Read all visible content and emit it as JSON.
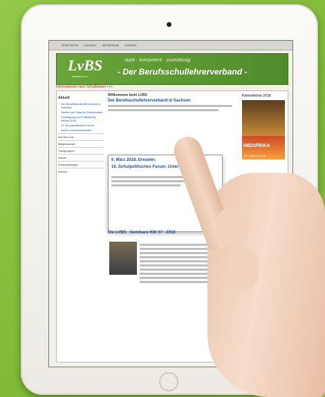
{
  "topbar": [
    "STARTSEITE",
    "KONTAKT",
    "IMPRESSUM",
    "SITEMAP"
  ],
  "banner": {
    "logo": "LvBS",
    "logo_sub": "Sachsen e.V.",
    "tagline": "stark · kompetent · zuverlässig",
    "title": "- Der Berufsschullehrerverband -"
  },
  "ticker": "Informationen nach Schulfrieden +++",
  "sidebar": {
    "heading": "Aktuell",
    "items": [
      "Der Berufsschullehrerverband in Sachsen",
      "Rechts und Tipps für Referendare",
      "Fachtagung und Fortbildung Herbst 2018",
      "10. Schulpolitisches Forum",
      "Archiv und Informationen"
    ],
    "menu": [
      "Wir über uns",
      "Mitgliedschaft",
      "Fachgruppen",
      "Presse",
      "Veranstaltungen",
      "Service"
    ]
  },
  "main": {
    "heading": "Willkommen beim LVBS",
    "subheading": "Der Berufsschullehrerverband in Sachsen",
    "article_heading": "Die LVBS - Seminare KW 37 - 2018"
  },
  "popup": {
    "date": "9. März 2018, Dresden:",
    "title": "10. Schulpolitisches Forum: Unterricht digital"
  },
  "poster": {
    "label": "HIDAFRIKA",
    "date": "19. Oktober 2018"
  },
  "right_heading": "Partnerbörse 2018"
}
